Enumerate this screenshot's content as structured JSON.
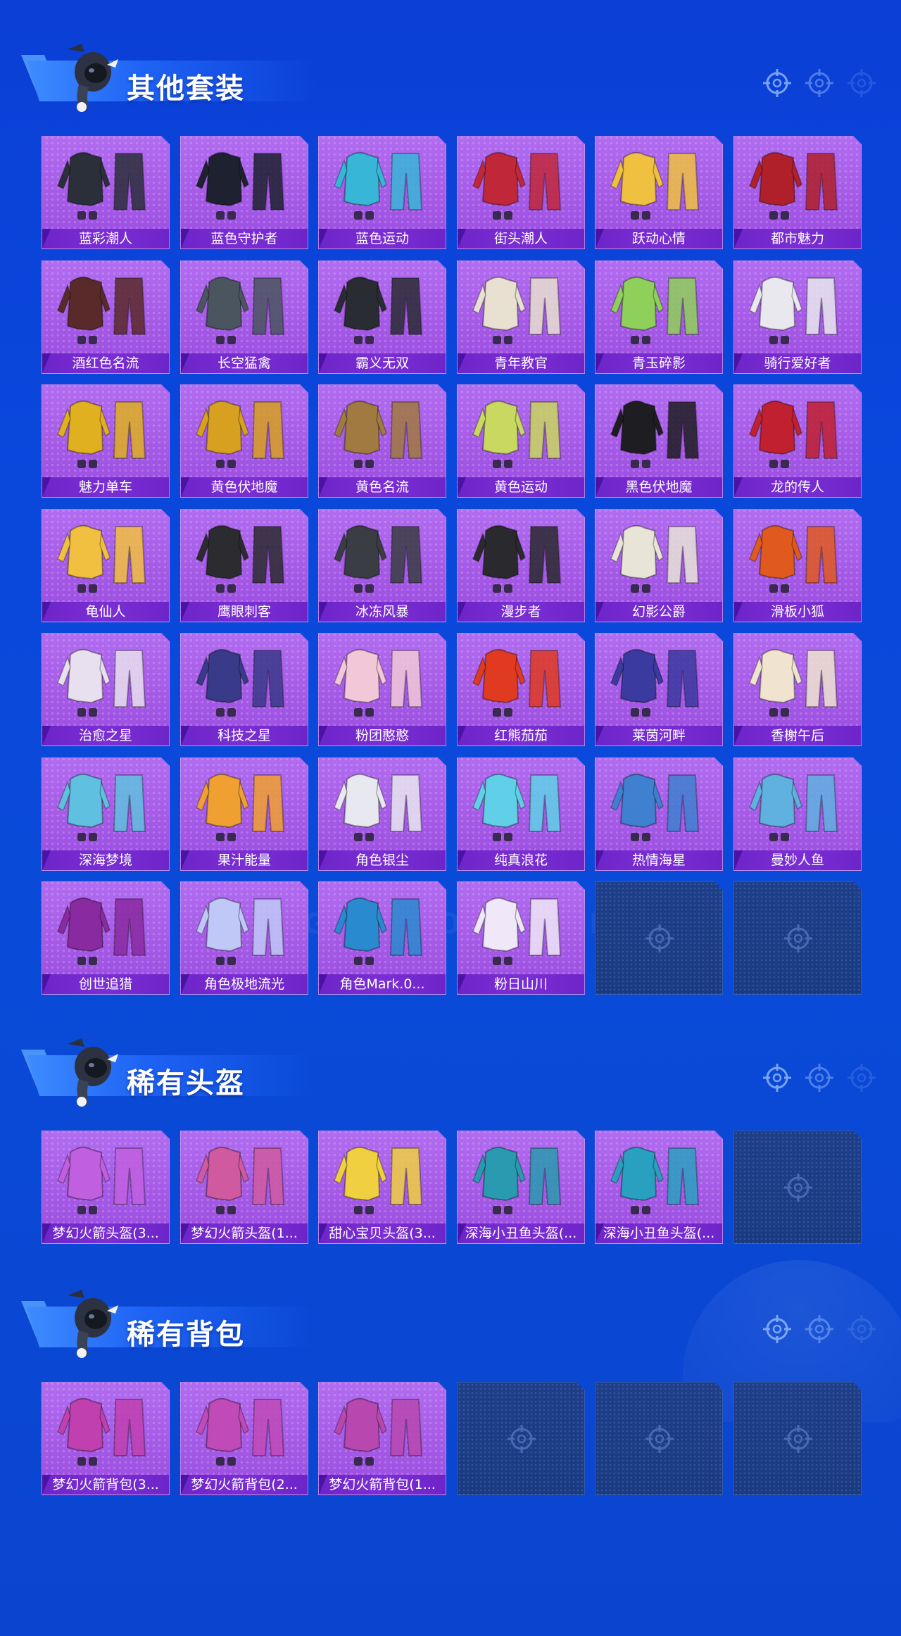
{
  "sections": [
    {
      "title": "其他套装",
      "items": [
        "蓝彩潮人",
        "蓝色守护者",
        "蓝色运动",
        "街头潮人",
        "跃动心情",
        "都市魅力",
        "酒红色名流",
        "长空猛禽",
        "霸义无双",
        "青年教官",
        "青玉碎影",
        "骑行爱好者",
        "魅力单车",
        "黄色伏地魔",
        "黄色名流",
        "黄色运动",
        "黑色伏地魔",
        "龙的传人",
        "龟仙人",
        "鹰眼刺客",
        "冰冻风暴",
        "漫步者",
        "幻影公爵",
        "滑板小狐",
        "治愈之星",
        "科技之星",
        "粉团憨憨",
        "红熊茄茄",
        "莱茵河畔",
        "香榭午后",
        "深海梦境",
        "果汁能量",
        "角色银尘",
        "纯真浪花",
        "热情海星",
        "曼妙人鱼",
        "创世追猎",
        "角色极地流光",
        "角色Mark.0...",
        "粉日山川"
      ],
      "empty_slots": 2,
      "item_colors": [
        "#2b2f3a",
        "#1e2230",
        "#38b6d8",
        "#c0283a",
        "#f0c040",
        "#b0202a",
        "#5a2a2a",
        "#4a5560",
        "#2a2c34",
        "#e8e0d0",
        "#8fd05a",
        "#e8e8ee",
        "#e0b020",
        "#d8a020",
        "#a07a40",
        "#c8d860",
        "#1e1e22",
        "#c02030",
        "#f2c040",
        "#2c2c30",
        "#3a3e44",
        "#2a2a2e",
        "#e8e4d8",
        "#e05a20",
        "#e8e0ee",
        "#3a3a8a",
        "#f2c8d8",
        "#e03a20",
        "#3a3aa0",
        "#f0e4d0",
        "#60c0e0",
        "#f0a030",
        "#e8e8f0",
        "#60d0e8",
        "#4080d0",
        "#60b0e0",
        "#8a2aa0",
        "#c0c8f8",
        "#2a8ad0",
        "#f0e8f8"
      ]
    },
    {
      "title": "稀有头盔",
      "items": [
        "梦幻火箭头盔(3...",
        "梦幻火箭头盔(1...",
        "甜心宝贝头盔(3...",
        "深海小丑鱼头盔(...",
        "深海小丑鱼头盔(..."
      ],
      "empty_slots": 1,
      "item_colors": [
        "#c060e0",
        "#d05aa0",
        "#f0d040",
        "#2a9ab0",
        "#2aa0c0"
      ]
    },
    {
      "title": "稀有背包",
      "items": [
        "梦幻火箭背包(3...",
        "梦幻火箭背包(2...",
        "梦幻火箭背包(1..."
      ],
      "empty_slots": 3,
      "item_colors": [
        "#c040b0",
        "#c04ab8",
        "#b848b0"
      ]
    }
  ],
  "watermark": "GAME FOR PEACE"
}
